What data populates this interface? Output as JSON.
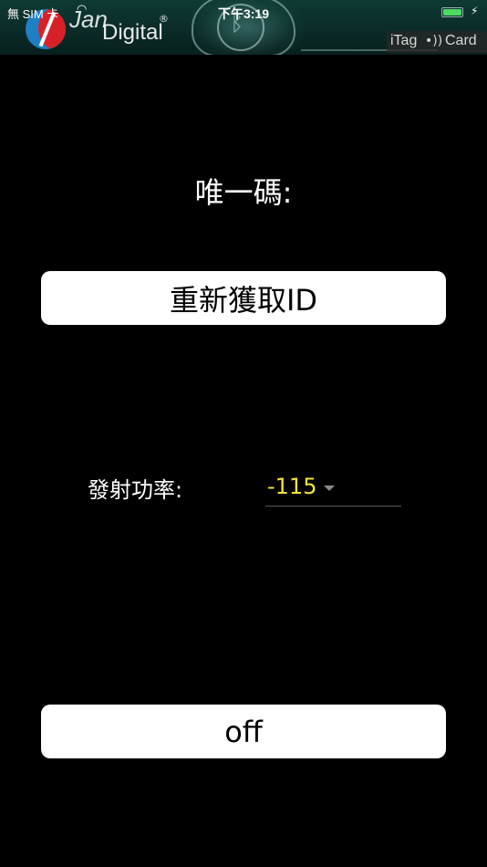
{
  "status_bar": {
    "carrier": "無 SIM 卡",
    "time": "下午3:19",
    "battery_level": 0.9,
    "battery_color": "#4cd964"
  },
  "header": {
    "brand_jan": "Jan",
    "brand_digital": "Digital",
    "brand_registered": "®",
    "badge_itag": "iTag",
    "badge_card": "Card",
    "icons": [
      "jan-digital-logo-icon",
      "bluetooth-cloud-icon",
      "wifi-icon",
      "nfc-signal-icon",
      "battery-icon",
      "charging-bolt-icon"
    ]
  },
  "main": {
    "unique_code_label": "唯一碼:",
    "refresh_id_button": "重新獲取ID",
    "power_label": "發射功率:",
    "power_value": "-115",
    "off_button": "off"
  },
  "colors": {
    "background": "#000000",
    "button_bg": "#ffffff",
    "power_value": "#f5e33c",
    "header_bg": "#0b2b28"
  }
}
